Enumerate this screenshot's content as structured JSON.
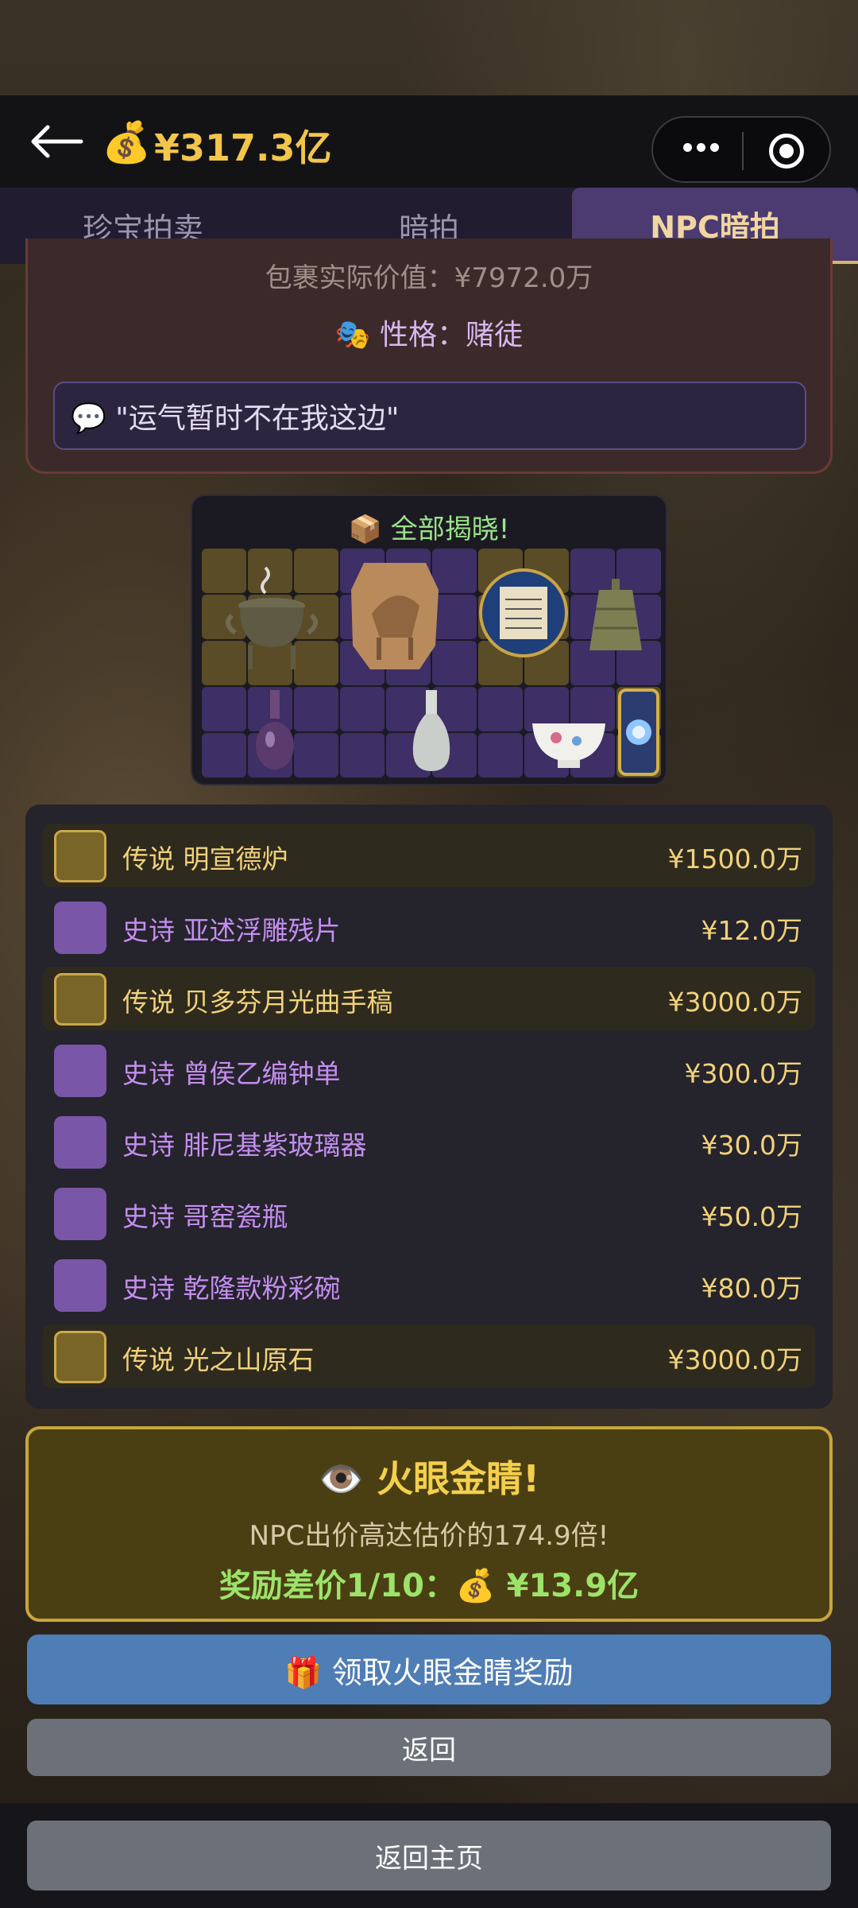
{
  "header": {
    "balance": "¥317.3亿",
    "coin_icon": "money-bag-icon"
  },
  "tabs": [
    {
      "label": "珍宝拍卖"
    },
    {
      "label": "暗拍"
    },
    {
      "label": "NPC暗拍"
    }
  ],
  "npc": {
    "value_text": "包裹实际价值：¥7972.0万",
    "personality_text": "🎭 性格：赌徒",
    "quote_text": "💬 \"运气暂时不在我这边\""
  },
  "reveal": {
    "title": "📦 全部揭晓!"
  },
  "items": [
    {
      "rarity": "legend",
      "name": "传说 明宣德炉",
      "price": "¥1500.0万"
    },
    {
      "rarity": "epic",
      "name": "史诗 亚述浮雕残片",
      "price": "¥12.0万"
    },
    {
      "rarity": "legend",
      "name": "传说 贝多芬月光曲手稿",
      "price": "¥3000.0万"
    },
    {
      "rarity": "epic",
      "name": "史诗 曾侯乙编钟单",
      "price": "¥300.0万"
    },
    {
      "rarity": "epic",
      "name": "史诗 腓尼基紫玻璃器",
      "price": "¥30.0万"
    },
    {
      "rarity": "epic",
      "name": "史诗 哥窑瓷瓶",
      "price": "¥50.0万"
    },
    {
      "rarity": "epic",
      "name": "史诗 乾隆款粉彩碗",
      "price": "¥80.0万"
    },
    {
      "rarity": "legend",
      "name": "传说 光之山原石",
      "price": "¥3000.0万"
    }
  ],
  "reward": {
    "title": "👁️ 火眼金睛!",
    "subtitle": "NPC出价高达估价的174.9倍!",
    "bonus": "奖励差价1/10：💰 ¥13.9亿"
  },
  "buttons": {
    "claim": "🎁 领取火眼金睛奖励",
    "back": "返回",
    "home": "返回主页"
  },
  "colors": {
    "legend": "#f1d27a",
    "epic": "#c38ef0",
    "accent_gold": "#f4cf4e",
    "tab_active_bg": "#4b3b70"
  }
}
